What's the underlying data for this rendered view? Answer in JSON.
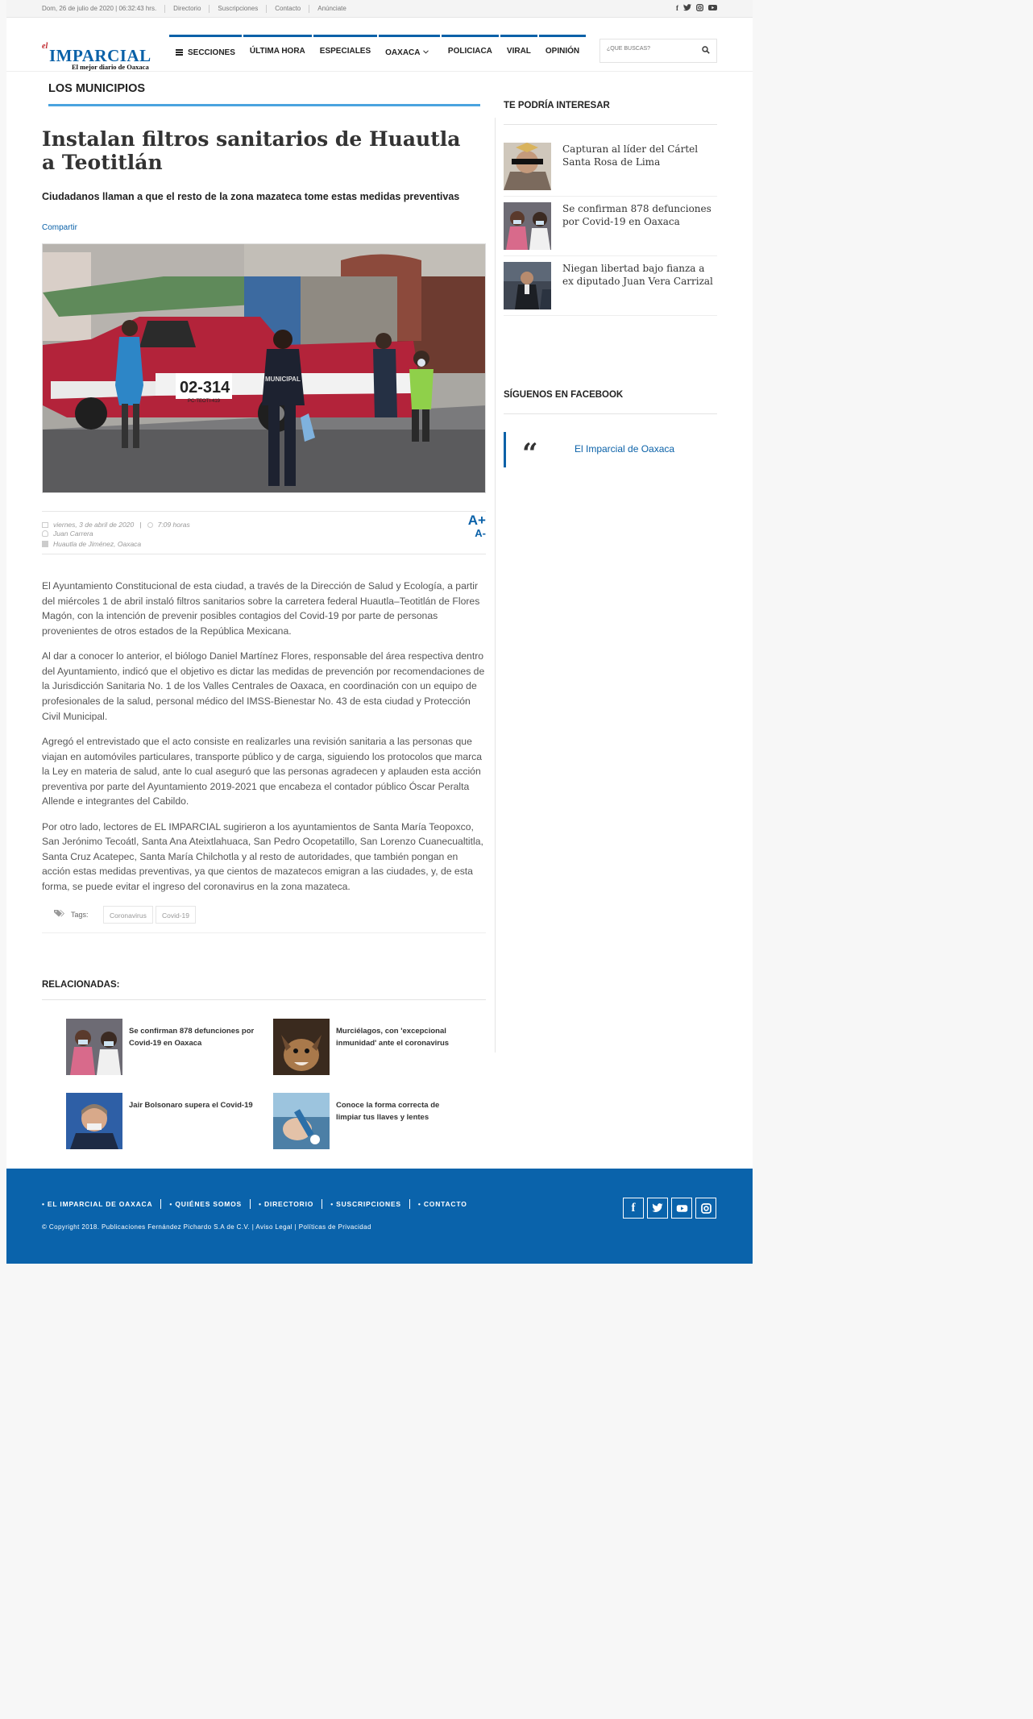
{
  "topbar": {
    "date": "Dom, 26 de julio de 2020 | 06:32:43 hrs.",
    "links": [
      "Directorio",
      "Suscripciones",
      "Contacto",
      "Anúnciate"
    ],
    "social_icons": [
      "facebook-icon",
      "twitter-icon",
      "instagram-icon",
      "youtube-icon"
    ]
  },
  "logo": {
    "prefix": "el",
    "name": "IMPARCIAL",
    "tagline": "El mejor diario de Oaxaca"
  },
  "nav": {
    "items": [
      "SECCIONES",
      "ÚLTIMA HORA",
      "ESPECIALES",
      "OAXACA",
      "POLICIACA",
      "VIRAL",
      "OPINIÓN"
    ]
  },
  "search": {
    "placeholder": "¿QUÉ BUSCAS?"
  },
  "article": {
    "section": "LOS MUNICIPIOS",
    "title": "Instalan filtros sanitarios de Huautla a Teotitlán",
    "subtitle": "Ciudadanos llaman a que el resto de la zona mazateca tome estas medidas preventivas",
    "share": "Compartir",
    "photo_text": {
      "plate": "02-314",
      "unit": "PC-TEOTI-419",
      "vest": "MUNICIPAL"
    },
    "date": "viernes, 3 de abril de 2020",
    "time": "7:09 horas",
    "author": "Juan Carrera",
    "location": "Huautla de Jiménez, Oaxaca",
    "font_up": "A+",
    "font_down": "A-",
    "paragraphs": [
      "El Ayuntamiento Constitucional de esta ciudad, a través de la Dirección de Salud y Ecología, a partir del miércoles 1 de abril instaló filtros sanitarios sobre la carretera federal Huautla–Teotitlán de Flores Magón, con la intención de prevenir posibles contagios del Covid-19 por parte de personas provenientes de otros estados de la República Mexicana.",
      "Al dar a conocer lo anterior, el biólogo Daniel Martínez Flores, responsable del área respectiva dentro del Ayuntamiento, indicó que el objetivo es dictar las medidas de prevención por recomendaciones de la Jurisdicción Sanitaria No. 1 de los Valles Centrales de Oaxaca, en coordinación con un equipo de profesionales de la salud, personal médico del IMSS-Bienestar No. 43 de esta ciudad y Protección Civil Municipal.",
      "Agregó el entrevistado que el acto consiste en realizarles una revisión sanitaria a las personas que viajan en automóviles particulares, transporte público y de carga, siguiendo los protocolos que marca la Ley en materia de salud, ante lo cual aseguró que las personas agradecen y aplauden esta acción preventiva por parte del Ayuntamiento 2019-2021 que encabeza el contador público Óscar Peralta Allende e integrantes del Cabildo.",
      "Por otro lado, lectores de EL IMPARCIAL sugirieron a los ayuntamientos de Santa María Teopoxco, San Jerónimo Tecoátl, Santa Ana Ateixtlahuaca, San Pedro Ocopetatillo, San Lorenzo Cuanecualtitla, Santa Cruz Acatepec, Santa María Chilchotla y al resto de autoridades, que también pongan en acción estas medidas preventivas, ya que cientos de mazatecos emigran a las ciudades, y, de esta forma, se puede evitar el ingreso del coronavirus en la zona mazateca."
    ],
    "tags_label": "Tags:",
    "tags": [
      "Coronavirus",
      "Covid-19"
    ]
  },
  "related": {
    "title": "RELACIONADAS:",
    "items": [
      "Se confirman 878 defunciones por Covid-19 en Oaxaca",
      "Murciélagos, con 'excepcional inmunidad' ante el coronavirus",
      "Jair Bolsonaro supera el Covid-19",
      "Conoce la forma correcta de limpiar tus llaves y lentes"
    ]
  },
  "sidebar": {
    "interest_title": "TE PODRÍA INTERESAR",
    "interest_items": [
      "Capturan al líder del Cártel Santa Rosa de Lima",
      "Se confirman 878 defunciones por Covid-19 en Oaxaca",
      "Niegan libertad bajo fianza a ex diputado Juan Vera Carrizal"
    ],
    "facebook_title": "SÍGUENOS EN FACEBOOK",
    "facebook_quote": "“",
    "facebook_page": "El Imparcial de Oaxaca"
  },
  "footer": {
    "links": [
      "• EL IMPARCIAL DE OAXACA",
      "• QUIÉNES SOMOS",
      "• DIRECTORIO",
      "• SUSCRIPCIONES",
      "• CONTACTO"
    ],
    "copyright": "© Copyright 2018. Publicaciones Fernández Pichardo S.A de C.V. | Aviso Legal | Políticas de Privacidad",
    "social_icons": [
      "facebook-icon",
      "twitter-icon",
      "youtube-icon",
      "instagram-icon"
    ]
  },
  "colors": {
    "brand": "#0a61a8",
    "footer": "#0a63ab",
    "accent_line": "#4aa3df",
    "logo_red": "#c0272d"
  }
}
